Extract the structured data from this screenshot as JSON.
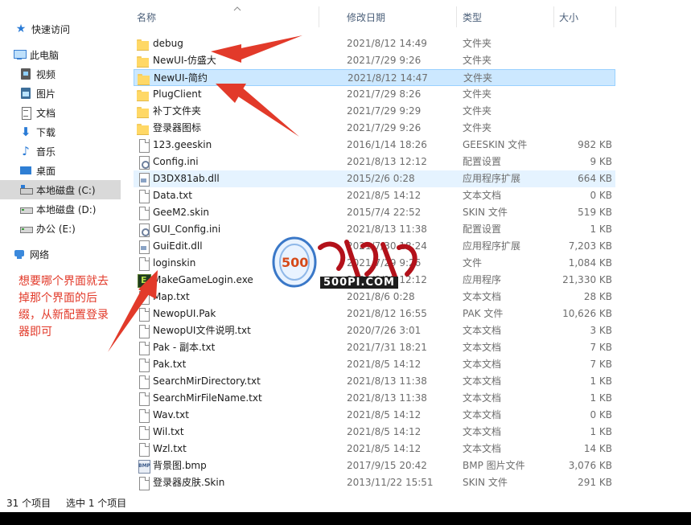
{
  "columns": {
    "name": "名称",
    "date": "修改日期",
    "type": "类型",
    "size": "大小"
  },
  "nav": [
    {
      "label": "快速访问",
      "icon": "star-icon",
      "selected": false
    },
    {
      "label": "此电脑",
      "icon": "computer-icon",
      "selected": false
    },
    {
      "label": "视频",
      "icon": "video-folder-icon",
      "selected": false
    },
    {
      "label": "图片",
      "icon": "pictures-folder-icon",
      "selected": false
    },
    {
      "label": "文档",
      "icon": "documents-folder-icon",
      "selected": false
    },
    {
      "label": "下载",
      "icon": "download-arrow-icon",
      "selected": false
    },
    {
      "label": "音乐",
      "icon": "music-note-icon",
      "selected": false
    },
    {
      "label": "桌面",
      "icon": "desktop-icon",
      "selected": false
    },
    {
      "label": "本地磁盘 (C:)",
      "icon": "system-drive-icon",
      "selected": true
    },
    {
      "label": "本地磁盘 (D:)",
      "icon": "drive-icon",
      "selected": false
    },
    {
      "label": "办公 (E:)",
      "icon": "drive-icon",
      "selected": false
    },
    {
      "label": "网络",
      "icon": "network-icon",
      "selected": false
    }
  ],
  "files": [
    {
      "name": "debug",
      "date": "2021/8/12 14:49",
      "type": "文件夹",
      "size": "",
      "icon": "folder-icon"
    },
    {
      "name": "NewUI-仿盛大",
      "date": "2021/7/29 9:26",
      "type": "文件夹",
      "size": "",
      "icon": "folder-icon"
    },
    {
      "name": "NewUI-简约",
      "date": "2021/8/12 14:47",
      "type": "文件夹",
      "size": "",
      "icon": "folder-icon"
    },
    {
      "name": "PlugClient",
      "date": "2021/7/29 8:26",
      "type": "文件夹",
      "size": "",
      "icon": "folder-icon"
    },
    {
      "name": "补丁文件夹",
      "date": "2021/7/29 9:29",
      "type": "文件夹",
      "size": "",
      "icon": "folder-icon"
    },
    {
      "name": "登录器图标",
      "date": "2021/7/29 9:26",
      "type": "文件夹",
      "size": "",
      "icon": "folder-icon"
    },
    {
      "name": "123.geeskin",
      "date": "2016/1/14 18:26",
      "type": "GEESKIN 文件",
      "size": "982 KB",
      "icon": "file-icon"
    },
    {
      "name": "Config.ini",
      "date": "2021/8/13 12:12",
      "type": "配置设置",
      "size": "9 KB",
      "icon": "settings-file-icon"
    },
    {
      "name": "D3DX81ab.dll",
      "date": "2015/2/6 0:28",
      "type": "应用程序扩展",
      "size": "664 KB",
      "icon": "dll-file-icon"
    },
    {
      "name": "Data.txt",
      "date": "2021/8/5 14:12",
      "type": "文本文档",
      "size": "0 KB",
      "icon": "file-icon"
    },
    {
      "name": "GeeM2.skin",
      "date": "2015/7/4 22:52",
      "type": "SKIN 文件",
      "size": "519 KB",
      "icon": "file-icon"
    },
    {
      "name": "GUI_Config.ini",
      "date": "2021/8/13 11:38",
      "type": "配置设置",
      "size": "1 KB",
      "icon": "settings-file-icon"
    },
    {
      "name": "GuiEdit.dll",
      "date": "2021/7/30 18:24",
      "type": "应用程序扩展",
      "size": "7,203 KB",
      "icon": "dll-file-icon"
    },
    {
      "name": "loginskin",
      "date": "2021/7/29 9:26",
      "type": "文件",
      "size": "1,084 KB",
      "icon": "file-icon"
    },
    {
      "name": "MakeGameLogin.exe",
      "date": "2021/8/13 12:12",
      "type": "应用程序",
      "size": "21,330 KB",
      "icon": "exe-file-icon"
    },
    {
      "name": "Map.txt",
      "date": "2021/8/6 0:28",
      "type": "文本文档",
      "size": "28 KB",
      "icon": "file-icon"
    },
    {
      "name": "NewopUI.Pak",
      "date": "2021/8/12 16:55",
      "type": "PAK 文件",
      "size": "10,626 KB",
      "icon": "file-icon"
    },
    {
      "name": "NewopUI文件说明.txt",
      "date": "2020/7/26 3:01",
      "type": "文本文档",
      "size": "3 KB",
      "icon": "file-icon"
    },
    {
      "name": "Pak - 副本.txt",
      "date": "2021/7/31 18:21",
      "type": "文本文档",
      "size": "7 KB",
      "icon": "file-icon"
    },
    {
      "name": "Pak.txt",
      "date": "2021/8/5 14:12",
      "type": "文本文档",
      "size": "7 KB",
      "icon": "file-icon"
    },
    {
      "name": "SearchMirDirectory.txt",
      "date": "2021/8/13 11:38",
      "type": "文本文档",
      "size": "1 KB",
      "icon": "file-icon"
    },
    {
      "name": "SearchMirFileName.txt",
      "date": "2021/8/13 11:38",
      "type": "文本文档",
      "size": "1 KB",
      "icon": "file-icon"
    },
    {
      "name": "Wav.txt",
      "date": "2021/8/5 14:12",
      "type": "文本文档",
      "size": "0 KB",
      "icon": "file-icon"
    },
    {
      "name": "Wil.txt",
      "date": "2021/8/5 14:12",
      "type": "文本文档",
      "size": "1 KB",
      "icon": "file-icon"
    },
    {
      "name": "Wzl.txt",
      "date": "2021/8/5 14:12",
      "type": "文本文档",
      "size": "14 KB",
      "icon": "file-icon"
    },
    {
      "name": "背景图.bmp",
      "date": "2017/9/15 20:42",
      "type": "BMP 图片文件",
      "size": "3,076 KB",
      "icon": "bmp-file-icon"
    },
    {
      "name": "登录器皮肤.Skin",
      "date": "2013/11/22 15:51",
      "type": "SKIN 文件",
      "size": "291 KB",
      "icon": "file-icon"
    }
  ],
  "selected_file_index": 2,
  "hover_file_index": 8,
  "annotation": "想要哪个界面就去掉那个界面的后缀，从新配置登录器即可",
  "watermark": {
    "site": "500PI.COM"
  },
  "status": {
    "count": "31 个项目",
    "selection": "选中 1 个项目"
  },
  "colors": {
    "annotation": "#e23a2a",
    "selection": "#cce8ff",
    "selection_border": "#99d1ff",
    "folder": "#ffd866"
  }
}
